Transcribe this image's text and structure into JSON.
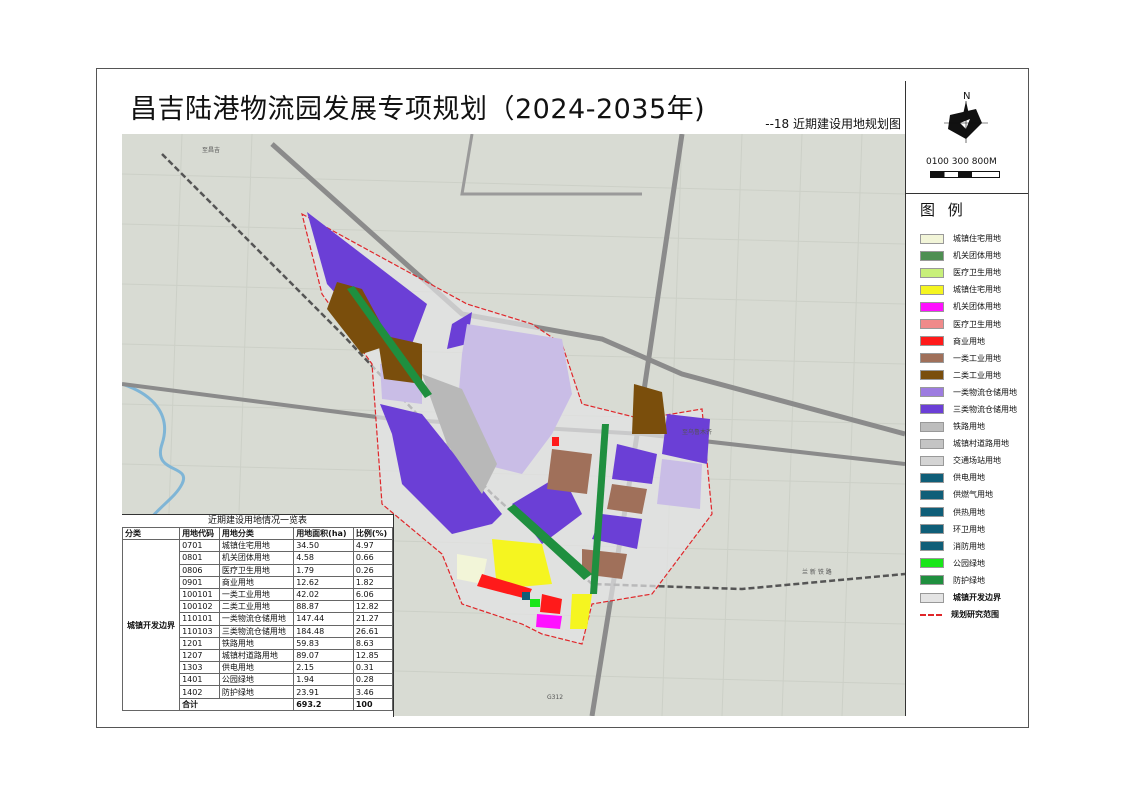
{
  "title": "昌吉陆港物流园发展专项规划（2024-2035年)",
  "subtitle": "--18 近期建设用地规划图",
  "compass": {
    "north_label": "N"
  },
  "scale": {
    "label": "0100 300 800M"
  },
  "legend": {
    "title": "图 例",
    "items": [
      {
        "label": "城镇住宅用地",
        "color": "#f2f5d8"
      },
      {
        "label": "机关团体用地",
        "color": "#4e8f52"
      },
      {
        "label": "医疗卫生用地",
        "color": "#c8f07a"
      },
      {
        "label": "城镇住宅用地",
        "color": "#f5f520"
      },
      {
        "label": "机关团体用地",
        "color": "#ff10ff"
      },
      {
        "label": "医疗卫生用地",
        "color": "#f08a8a"
      },
      {
        "label": "商业用地",
        "color": "#ff1a1a"
      },
      {
        "label": "一类工业用地",
        "color": "#a0705a"
      },
      {
        "label": "二类工业用地",
        "color": "#7a4e0c"
      },
      {
        "label": "一类物流仓储用地",
        "color": "#9d7ce0"
      },
      {
        "label": "三类物流仓储用地",
        "color": "#6b3fd6"
      },
      {
        "label": "铁路用地",
        "color": "#bdbdbd"
      },
      {
        "label": "城镇村道路用地",
        "color": "#c4c4c4"
      },
      {
        "label": "交通场站用地",
        "color": "#d4d4d4"
      },
      {
        "label": "供电用地",
        "color": "#0f5e78"
      },
      {
        "label": "供燃气用地",
        "color": "#0f5e78"
      },
      {
        "label": "供热用地",
        "color": "#0f5e78"
      },
      {
        "label": "环卫用地",
        "color": "#0f5e78"
      },
      {
        "label": "消防用地",
        "color": "#0f5e78"
      },
      {
        "label": "公园绿地",
        "color": "#19e619"
      },
      {
        "label": "防护绿地",
        "color": "#1f8f3f"
      },
      {
        "label": "城镇开发边界",
        "color": "#e4e4e4"
      },
      {
        "label": "规划研究范围",
        "color": "#e0262a"
      }
    ]
  },
  "table": {
    "title": "近期建设用地情况一览表",
    "headers": [
      "分类",
      "用地代码",
      "用地分类",
      "用地面积(ha)",
      "比例(%)"
    ],
    "category": "城镇开发边界",
    "rows": [
      {
        "code": "0701",
        "name": "城镇住宅用地",
        "area": "34.50",
        "ratio": "4.97"
      },
      {
        "code": "0801",
        "name": "机关团体用地",
        "area": "4.58",
        "ratio": "0.66"
      },
      {
        "code": "0806",
        "name": "医疗卫生用地",
        "area": "1.79",
        "ratio": "0.26"
      },
      {
        "code": "0901",
        "name": "商业用地",
        "area": "12.62",
        "ratio": "1.82"
      },
      {
        "code": "100101",
        "name": "一类工业用地",
        "area": "42.02",
        "ratio": "6.06"
      },
      {
        "code": "100102",
        "name": "二类工业用地",
        "area": "88.87",
        "ratio": "12.82"
      },
      {
        "code": "110101",
        "name": "一类物流仓储用地",
        "area": "147.44",
        "ratio": "21.27"
      },
      {
        "code": "110103",
        "name": "三类物流仓储用地",
        "area": "184.48",
        "ratio": "26.61"
      },
      {
        "code": "1201",
        "name": "铁路用地",
        "area": "59.83",
        "ratio": "8.63"
      },
      {
        "code": "1207",
        "name": "城镇村道路用地",
        "area": "89.07",
        "ratio": "12.85"
      },
      {
        "code": "1303",
        "name": "供电用地",
        "area": "2.15",
        "ratio": "0.31"
      },
      {
        "code": "1401",
        "name": "公园绿地",
        "area": "1.94",
        "ratio": "0.28"
      },
      {
        "code": "1402",
        "name": "防护绿地",
        "area": "23.91",
        "ratio": "3.46"
      }
    ],
    "total": {
      "label": "合计",
      "area": "693.2",
      "ratio": "100"
    }
  },
  "map_labels": {
    "road_north": "至昌吉",
    "road_east": "至乌鲁木齐",
    "rail": "兰 新 铁 路",
    "highway": "G312"
  }
}
